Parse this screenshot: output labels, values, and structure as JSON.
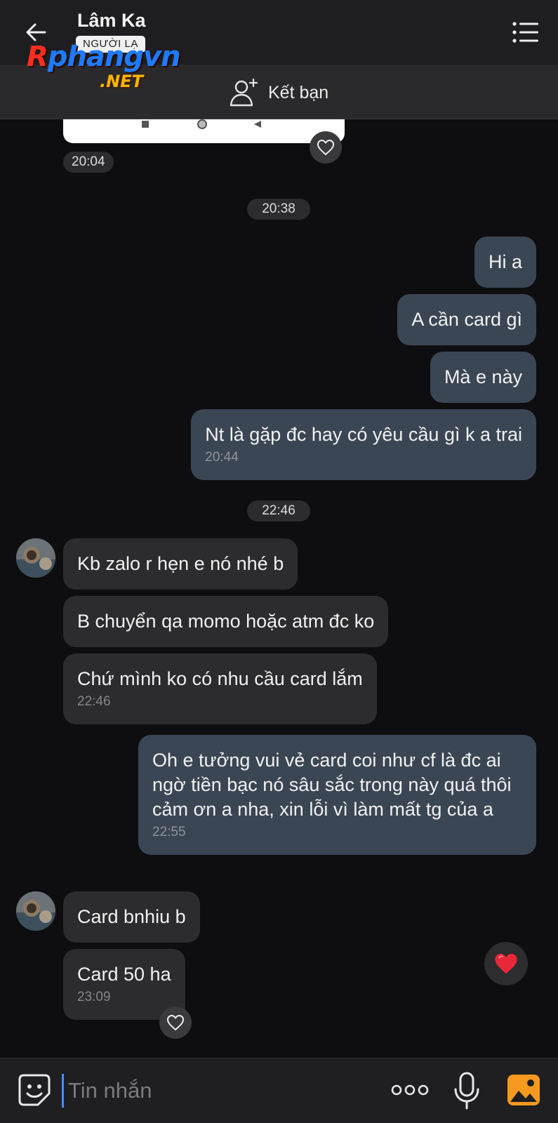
{
  "header": {
    "title": "Lâm Ka",
    "badge": "NGƯỜI LẠ",
    "watermark_main_1": "R",
    "watermark_main_2": "phangvn",
    "watermark_sub": ".NET",
    "add_friend_label": "Kết bạn"
  },
  "chat": {
    "time_1": "20:04",
    "time_2": "20:38",
    "time_3": "22:46",
    "messages": [
      {
        "side": "out",
        "text": "Hi a"
      },
      {
        "side": "out",
        "text": "A cần card gì"
      },
      {
        "side": "out",
        "text": "Mà e này"
      },
      {
        "side": "out",
        "text": "Nt là gặp đc hay có yêu cầu gì k a trai",
        "time": "20:44"
      },
      {
        "side": "in",
        "text": "Kb zalo r hẹn e nó nhé b"
      },
      {
        "side": "in",
        "text": "B chuyển qa momo hoặc atm đc ko"
      },
      {
        "side": "in",
        "text": "Chứ mình ko có nhu cầu card lắm",
        "time": "22:46"
      },
      {
        "side": "out",
        "text": "Oh e tưởng vui vẻ card coi như cf là đc ai ngờ tiền bạc nó sâu sắc trong này quá thôi cảm ơn a nha, xin lỗi vì làm mất tg của a",
        "time": "22:55"
      },
      {
        "side": "in",
        "text": "Card bnhiu b"
      },
      {
        "side": "in",
        "text": "Card 50 ha",
        "time": "23:09"
      }
    ]
  },
  "composer": {
    "placeholder": "Tin nhắn"
  },
  "icons": {
    "back": "arrow-left-icon",
    "menu": "list-menu-icon",
    "add_friend": "add-user-icon",
    "heart": "heart-outline-icon",
    "reaction": "heart-filled-icon",
    "emoji": "sticker-icon",
    "more": "more-dots-icon",
    "mic": "microphone-icon",
    "photo": "image-icon"
  },
  "colors": {
    "outgoing_bubble": "#3b4654",
    "incoming_bubble": "#2c2c2e",
    "reaction_heart": "#e8283a",
    "photo_icon": "#f59a1f"
  }
}
